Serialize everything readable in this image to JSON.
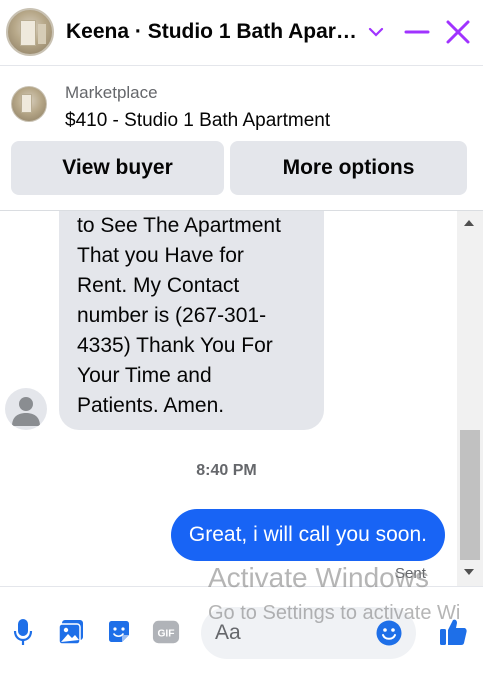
{
  "header": {
    "title": "Keena · Studio 1 Bath Apar…",
    "icons": [
      "chevron-down-icon",
      "minimize-icon",
      "close-icon"
    ],
    "accent_color": "#a033ff"
  },
  "marketplace": {
    "label": "Marketplace",
    "listing": "$410 - Studio 1 Bath Apartment",
    "view_buyer_label": "View buyer",
    "more_options_label": "More options"
  },
  "conversation": {
    "incoming_text": "to See The Apartment\nThat you Have for\nRent. My Contact\nnumber is (267-301-\n4335) Thank You For\nYour Time and\nPatients. Amen.",
    "timestamp": "8:40 PM",
    "outgoing_text": "Great, i will call you soon.",
    "outgoing_color": "#1864f5",
    "status": "Sent"
  },
  "composer": {
    "placeholder": "Aa",
    "icons": [
      "microphone-icon",
      "photo-icon",
      "sticker-icon",
      "gif-icon",
      "emoji-icon",
      "thumbs-up-icon"
    ],
    "gif_label": "GIF"
  },
  "watermark": {
    "line1": "Activate Windows",
    "line2": "Go to Settings to activate Wi"
  }
}
